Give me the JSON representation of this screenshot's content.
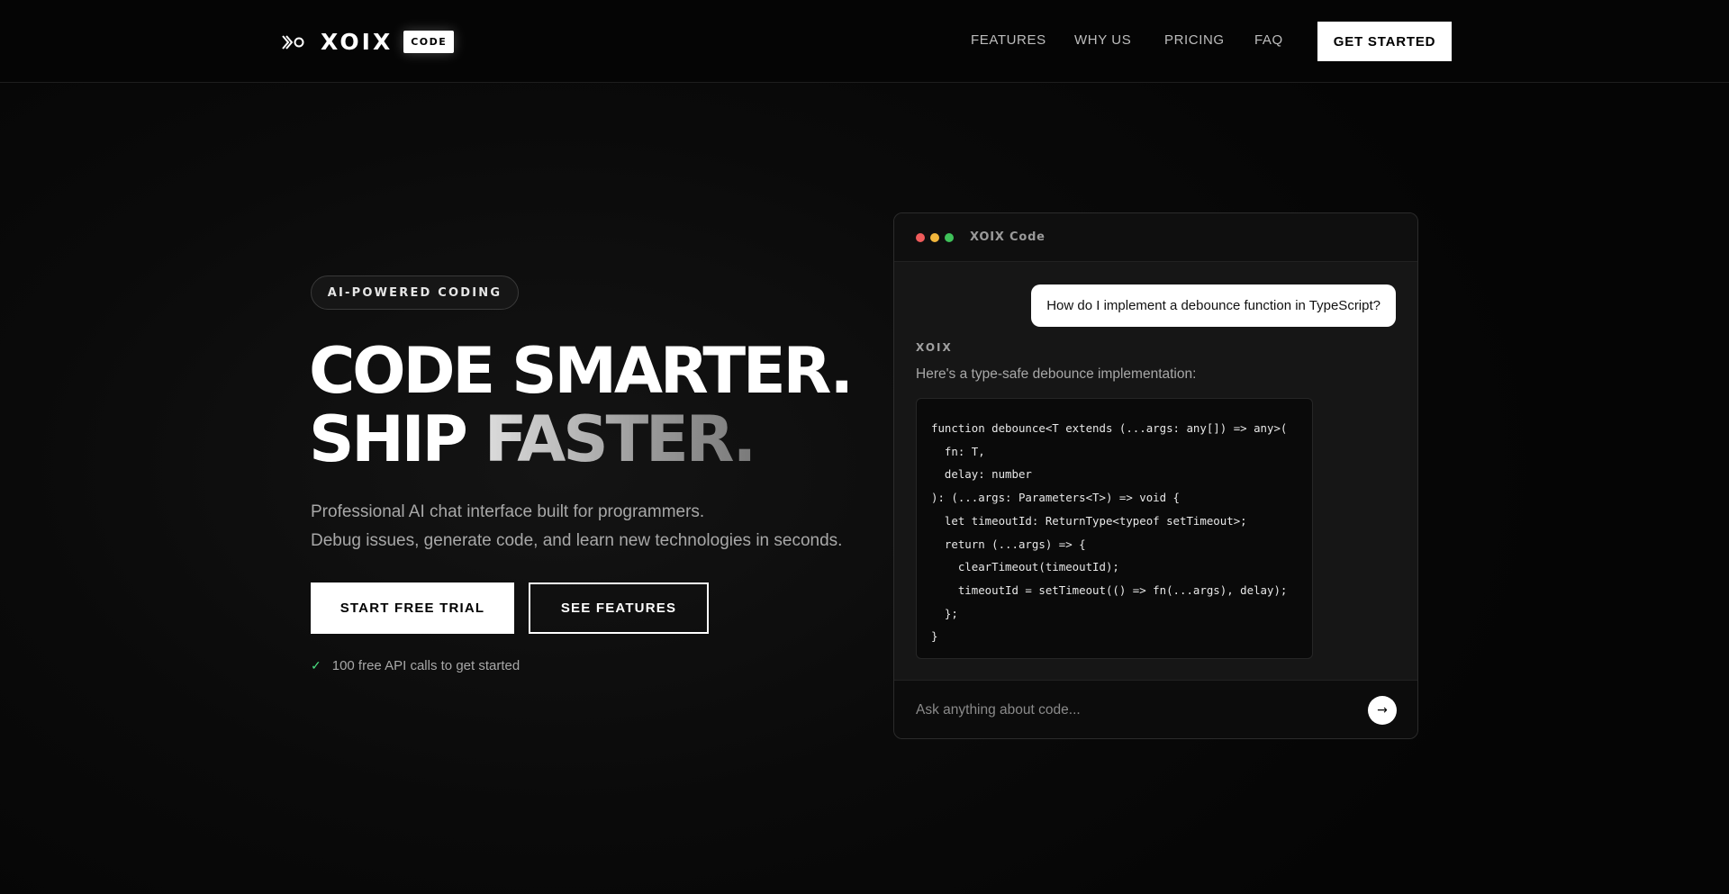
{
  "nav": {
    "brand_name": "XOIX",
    "brand_badge": "CODE",
    "links": [
      "FEATURES",
      "WHY US",
      "PRICING",
      "FAQ"
    ],
    "cta": "GET STARTED"
  },
  "hero": {
    "pill": "AI-POWERED CODING",
    "headline_line1": "CODE SMARTER.",
    "headline_line2_a": "SHIP ",
    "headline_line2_b": "FASTER.",
    "subtitle_line1": "Professional AI chat interface built for programmers.",
    "subtitle_line2": "Debug issues, generate code, and learn new technologies in seconds.",
    "primary_button": "START FREE TRIAL",
    "secondary_button": "SEE FEATURES",
    "note_check": "✓",
    "note": "100 free API calls to get started"
  },
  "chat": {
    "window_title": "XOIX Code",
    "user_message": "How do I implement a debounce function in TypeScript?",
    "bot_name": "XOIX",
    "bot_text": "Here's a type-safe debounce implementation:",
    "code_lines": [
      "function debounce<T extends (...args: any[]) => any>(",
      "  fn: T,",
      "  delay: number",
      "): (...args: Parameters<T>) => void {",
      "  let timeoutId: ReturnType<typeof setTimeout>;",
      "  return (...args) => {",
      "    clearTimeout(timeoutId);",
      "    timeoutId = setTimeout(() => fn(...args), delay);",
      "  };",
      "}"
    ],
    "input_placeholder": "Ask anything about code...",
    "send_icon": "→"
  },
  "colors": {
    "background": "#050505",
    "accent": "#ffffff",
    "check": "#4ade80",
    "dot_red": "#ef5b5b",
    "dot_yellow": "#f2b63c",
    "dot_green": "#3fc25a"
  }
}
